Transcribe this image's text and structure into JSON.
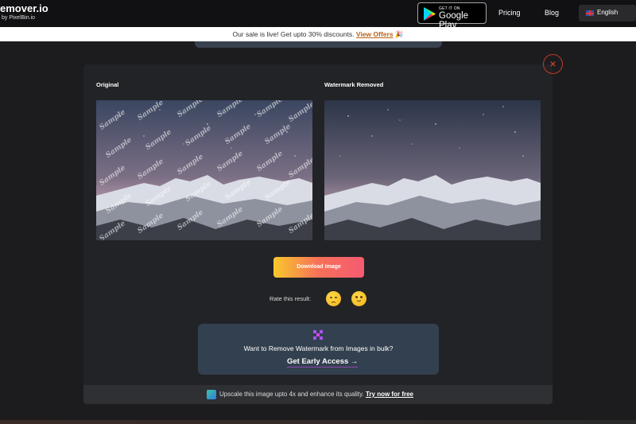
{
  "header": {
    "brand_name": "emover.io",
    "brand_by": "by PixelBin.io",
    "google_play_small": "GET IT ON",
    "google_play_big": "Google Play",
    "nav": [
      "Pricing",
      "Blog"
    ],
    "language": "English"
  },
  "sale_bar": {
    "text": "Our sale is live! Get upto 30% discounts.",
    "link": "View Offers",
    "emoji": "🎉"
  },
  "modal": {
    "close_symbol": "×",
    "original_label": "Original",
    "removed_label": "Watermark Removed",
    "watermark_word": "Sample",
    "download_label": "Download Image",
    "rate_label": "Rate this result:",
    "bulk": {
      "text": "Want to Remove Watermark from Images in bulk?",
      "link": "Get Early Access",
      "arrow": "→"
    },
    "upscale": {
      "text": "Upscale this image upto 4x and enhance its quality.",
      "link": "Try now for free"
    }
  },
  "icons": {
    "close": "close-icon",
    "sad": "sad-face-icon",
    "happy": "happy-face-icon",
    "bulk": "pixel-cross-icon",
    "upscale": "upscale-icon"
  },
  "colors": {
    "accent_gradient_start": "#f8c92c",
    "accent_gradient_end": "#f55a72",
    "offer_link": "#b8621b",
    "close_ring": "#c0392b"
  }
}
